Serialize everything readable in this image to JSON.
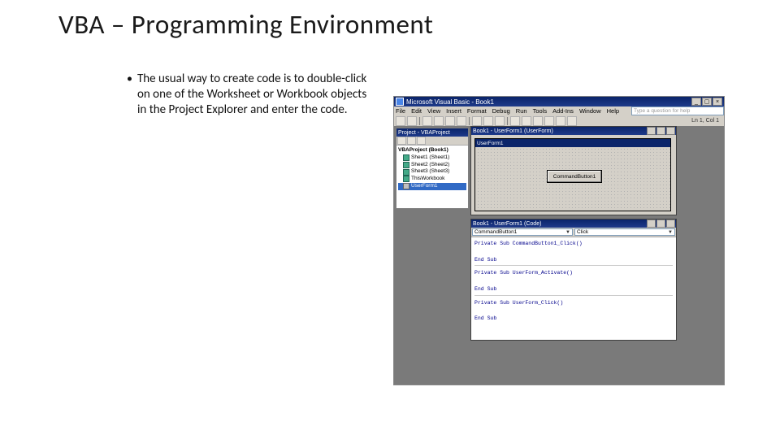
{
  "slide": {
    "title": "VBA – Programming Environment",
    "bullet": "The usual way to create code is to double-click on one of the Worksheet or Workbook objects in the Project Explorer and enter the code."
  },
  "ide": {
    "title": "Microsoft Visual Basic - Book1",
    "menus": [
      "File",
      "Edit",
      "View",
      "Insert",
      "Format",
      "Debug",
      "Run",
      "Tools",
      "Add-Ins",
      "Window",
      "Help"
    ],
    "help_placeholder": "Type a question for help",
    "coords": "Ln 1, Col 1",
    "project": {
      "title": "Project - VBAProject",
      "root": "VBAProject (Book1)",
      "items": [
        "Sheet1 (Sheet1)",
        "Sheet2 (Sheet2)",
        "Sheet3 (Sheet3)",
        "ThisWorkbook",
        "UserForm1"
      ]
    },
    "designer": {
      "title": "Book1 - UserForm1 (UserForm)",
      "form_caption": "UserForm1",
      "button_caption": "CommandButton1"
    },
    "code": {
      "title": "Book1 - UserForm1 (Code)",
      "dropdown_object": "CommandButton1",
      "dropdown_proc": "Click",
      "blocks": [
        {
          "sig": "Private Sub CommandButton1_Click()",
          "end": "End Sub"
        },
        {
          "sig": "Private Sub UserForm_Activate()",
          "end": "End Sub"
        },
        {
          "sig": "Private Sub UserForm_Click()",
          "end": "End Sub"
        }
      ]
    }
  }
}
